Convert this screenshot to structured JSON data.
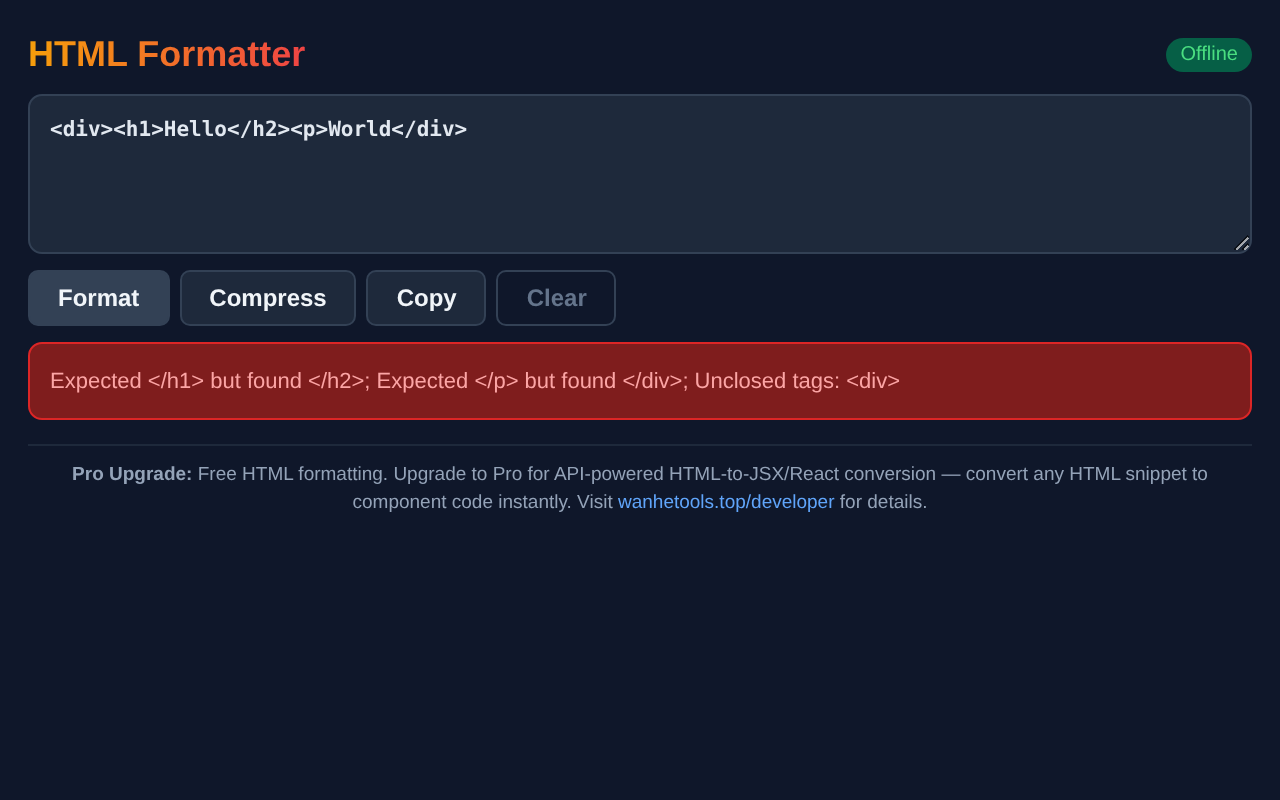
{
  "header": {
    "title": "HTML Formatter",
    "status": "Offline"
  },
  "editor": {
    "value": "<div><h1>Hello</h2><p>World</div>"
  },
  "buttons": [
    {
      "label": "Format",
      "kind": "primary",
      "disabled": false
    },
    {
      "label": "Compress",
      "kind": "secondary",
      "disabled": false
    },
    {
      "label": "Copy",
      "kind": "secondary",
      "disabled": false
    },
    {
      "label": "Clear",
      "kind": "secondary",
      "disabled": true
    }
  ],
  "error": {
    "message": "Expected </h1> but found </h2>; Expected </p> but found </div>; Unclosed tags: <div>"
  },
  "footer": {
    "text_before": "**Pro Upgrade:** Free HTML formatting. Upgrade to Pro for API-powered HTML-to-JSX/React conversion — convert any HTML snippet to component code instantly. Visit",
    "link": "wanhetools.top/developer",
    "text_after": "for details."
  }
}
